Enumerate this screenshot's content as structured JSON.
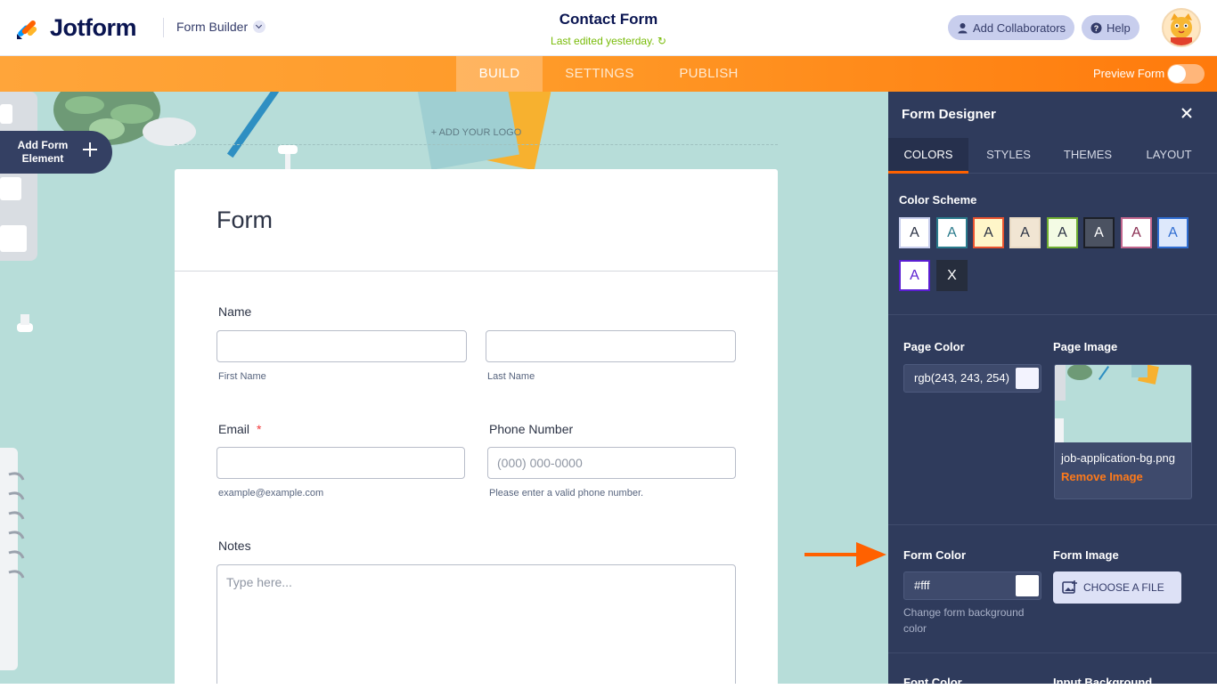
{
  "brand": {
    "name": "Jotform",
    "colors": {
      "accent": "#ff6100",
      "navy": "#0a1551",
      "panel": "#2f3b5c"
    }
  },
  "header": {
    "builder_label": "Form Builder",
    "form_title": "Contact Form",
    "last_edited": "Last edited yesterday.",
    "add_collaborators": "Add Collaborators",
    "help": "Help"
  },
  "nav": {
    "tabs": [
      {
        "label": "BUILD",
        "active": true
      },
      {
        "label": "SETTINGS",
        "active": false
      },
      {
        "label": "PUBLISH",
        "active": false
      }
    ],
    "preview_label": "Preview Form",
    "preview_on": false
  },
  "canvas": {
    "add_logo": "+ ADD YOUR LOGO",
    "add_element": "Add Form Element"
  },
  "form": {
    "title": "Form",
    "name_label": "Name",
    "first_name_sub": "First Name",
    "last_name_sub": "Last Name",
    "email_label": "Email",
    "email_required": "*",
    "email_sub": "example@example.com",
    "phone_label": "Phone Number",
    "phone_placeholder": "(000) 000-0000",
    "phone_sub": "Please enter a valid phone number.",
    "notes_label": "Notes",
    "notes_placeholder": "Type here..."
  },
  "designer": {
    "title": "Form Designer",
    "tabs": [
      {
        "label": "COLORS",
        "active": true
      },
      {
        "label": "STYLES",
        "active": false
      },
      {
        "label": "THEMES",
        "active": false
      },
      {
        "label": "LAYOUT",
        "active": false
      }
    ],
    "color_scheme_label": "Color Scheme",
    "swatches": [
      {
        "letter": "A",
        "bg": "#ffffff",
        "border": "#c8ceed",
        "fg": "#2c3345"
      },
      {
        "letter": "A",
        "bg": "#ffffff",
        "border": "#2b7b8c",
        "fg": "#2b7b8c"
      },
      {
        "letter": "A",
        "bg": "#fff6c9",
        "border": "#e8532f",
        "fg": "#2c3345"
      },
      {
        "letter": "A",
        "bg": "#f1e5d3",
        "border": "#e9dac4",
        "fg": "#2c3345"
      },
      {
        "letter": "A",
        "bg": "#f3fbe4",
        "border": "#6fae31",
        "fg": "#2c3345"
      },
      {
        "letter": "A",
        "bg": "#4b5261",
        "border": "#1c1f27",
        "fg": "#ffffff"
      },
      {
        "letter": "A",
        "bg": "#ffffff",
        "border": "#c2668d",
        "fg": "#8a2e52"
      },
      {
        "letter": "A",
        "bg": "#dde8fb",
        "border": "#2f6dd1",
        "fg": "#2f6dd1"
      },
      {
        "letter": "A",
        "bg": "#ffffff",
        "border": "#5a1ed1",
        "fg": "#5a1ed1"
      },
      {
        "letter": "X",
        "bg": "#262d3d",
        "border": "#262d3d",
        "fg": "#ffffff"
      }
    ],
    "page_color_label": "Page Color",
    "page_color_value": "rgb(243, 243, 254)",
    "page_image_label": "Page Image",
    "page_image_file": "job-application-bg.png",
    "remove_image": "Remove Image",
    "form_color_label": "Form Color",
    "form_color_value": "#fff",
    "form_color_hint": "Change form background color",
    "form_image_label": "Form Image",
    "choose_file": "CHOOSE A FILE",
    "font_color_label": "Font Color",
    "input_bg_label": "Input Background"
  }
}
